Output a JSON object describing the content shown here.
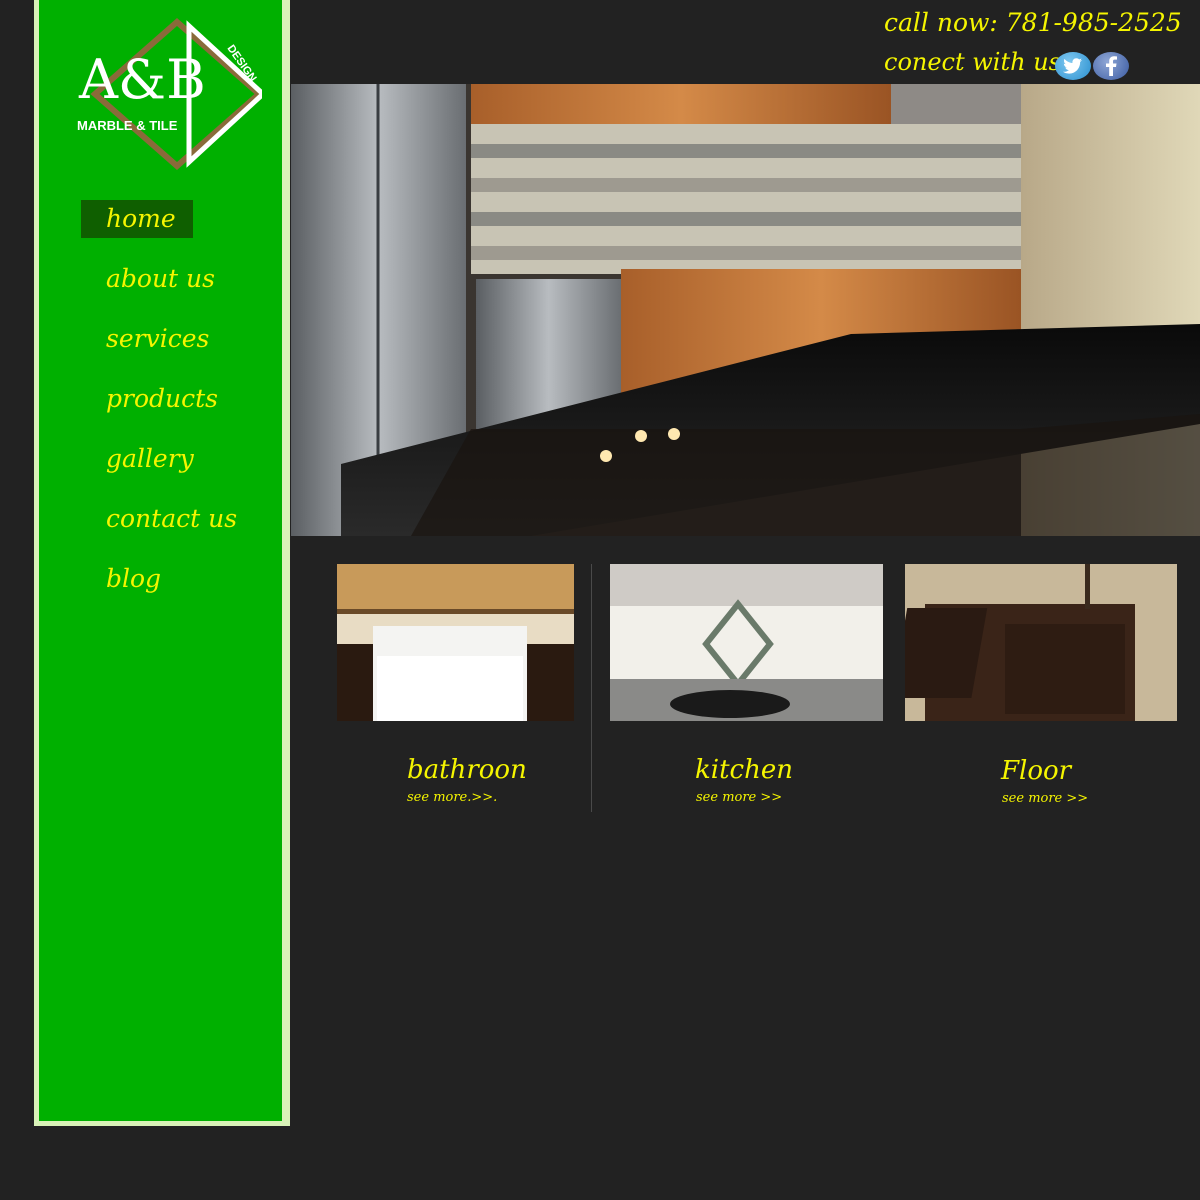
{
  "logo": {
    "letters": "A&B",
    "subtitle": "MARBLE & TILE",
    "tag": "DESIGN"
  },
  "nav": {
    "items": [
      {
        "label": "home",
        "active": true
      },
      {
        "label": "about us",
        "active": false
      },
      {
        "label": "services",
        "active": false
      },
      {
        "label": "products",
        "active": false
      },
      {
        "label": "gallery",
        "active": false
      },
      {
        "label": "contact us",
        "active": false
      },
      {
        "label": "blog",
        "active": false
      }
    ]
  },
  "header": {
    "call_now": "call now: 781-985-2525",
    "connect": "conect with us",
    "social": [
      "twitter-icon",
      "facebook-icon"
    ]
  },
  "cards": [
    {
      "title": "bathroon",
      "link": "see more.>>."
    },
    {
      "title": "kitchen",
      "link": "see more >>"
    },
    {
      "title": "Floor",
      "link": "see more >>"
    }
  ],
  "colors": {
    "sidebar": "#00b000",
    "accent_text": "#f5f500",
    "active_nav": "#0f5f00",
    "background": "#222222"
  }
}
